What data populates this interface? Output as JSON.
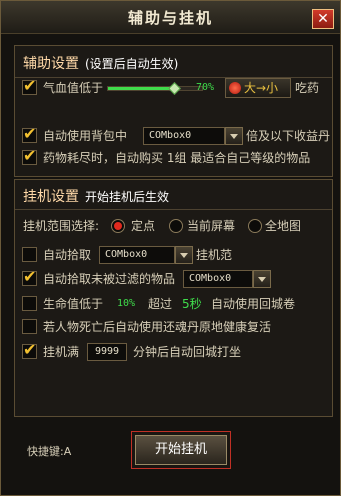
{
  "window": {
    "title": "辅助与挂机",
    "close_label": "✕"
  },
  "assist": {
    "title": "辅助设置",
    "subtitle": "(设置后自动生效)",
    "hp_low": {
      "checked": true,
      "label": "气血值低于",
      "slider_fraction": 0.7,
      "percent": "70%",
      "toggle_label": "大→小",
      "suffix": "吃药"
    },
    "use_bag": {
      "checked": true,
      "label": "自动使用背包中",
      "combo": "COMbox0",
      "suffix": "倍及以下收益丹"
    },
    "buy_potion": {
      "checked": true,
      "label": "药物耗尽时，自动购买 1组 最适合自己等级的物品"
    }
  },
  "hangup": {
    "title": "挂机设置",
    "subtitle": "开始挂机后生效",
    "range": {
      "label": "挂机范围选择:",
      "options": [
        {
          "label": "定点",
          "selected": true
        },
        {
          "label": "当前屏幕",
          "selected": false
        },
        {
          "label": "全地图",
          "selected": false
        }
      ]
    },
    "pickup": {
      "checked": false,
      "label": "自动拾取",
      "combo": "COMbox0",
      "suffix": "挂机范"
    },
    "pickup_filter": {
      "checked": true,
      "label": "自动拾取未被过滤的物品",
      "combo": "COMbox0"
    },
    "hp_return": {
      "checked": false,
      "label_a": "生命值低于",
      "value_a": "10%",
      "label_b": "超过",
      "value_b": "5秒",
      "label_c": "自动使用回城卷"
    },
    "revive": {
      "checked": false,
      "label": "若人物死亡后自动使用还魂丹原地健康复活"
    },
    "full": {
      "checked": true,
      "label": "挂机满",
      "value": "9999",
      "suffix": "分钟后自动回城打坐"
    }
  },
  "footer": {
    "hotkey": "快捷键:A",
    "start_button": "开始挂机"
  }
}
